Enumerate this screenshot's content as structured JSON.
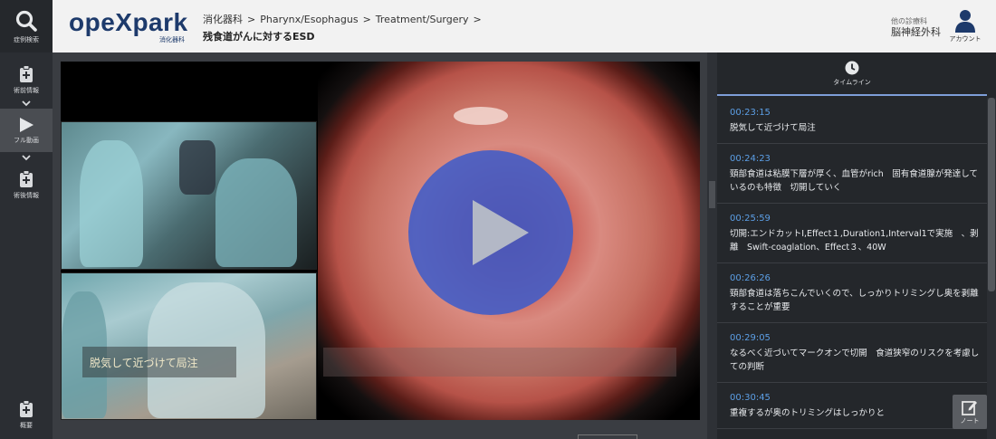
{
  "leftnav": {
    "search_label": "症例検索",
    "pre_op_label": "術前情報",
    "full_video_label": "フル動画",
    "post_op_label": "術後情報",
    "summary_label": "概要"
  },
  "header": {
    "logo": "opeXpark",
    "logo_sub": "消化器科",
    "breadcrumb": [
      "消化器科",
      "Pharynx/Esophagus",
      "Treatment/Surgery"
    ],
    "page_title": "残食道がんに対するESD",
    "other_dept_label": "他の診療科",
    "other_dept_name": "脳神経外科",
    "account_label": "アカウント"
  },
  "player": {
    "subtitle": "脱気して近づけて局注"
  },
  "timeline": {
    "tab_label": "タイムライン",
    "entries": [
      {
        "time": "00:23:15",
        "text": "脱気して近づけて局注"
      },
      {
        "time": "00:24:23",
        "text": "頸部食道は粘膜下層が厚く、血管がrich　固有食道腺が発達しているのも特徴　切開していく"
      },
      {
        "time": "00:25:59",
        "text": "切開:エンドカットI,Effect１,Duration1,Interval1で実施　、剥離　Swift-coaglation、Effect３、40W"
      },
      {
        "time": "00:26:26",
        "text": "頸部食道は落ちこんでいくので、しっかりトリミングし奥を剥離することが重要"
      },
      {
        "time": "00:29:05",
        "text": "なるべく近づいてマークオンで切開　食道狭窄のリスクを考慮しての判断"
      },
      {
        "time": "00:30:45",
        "text": "重複するが奥のトリミングはしっかりと"
      }
    ]
  },
  "note": {
    "label": "ノート"
  },
  "colors": {
    "accent": "#5c9fe6",
    "brand": "#1d3a6b",
    "play": "#405cc8"
  }
}
